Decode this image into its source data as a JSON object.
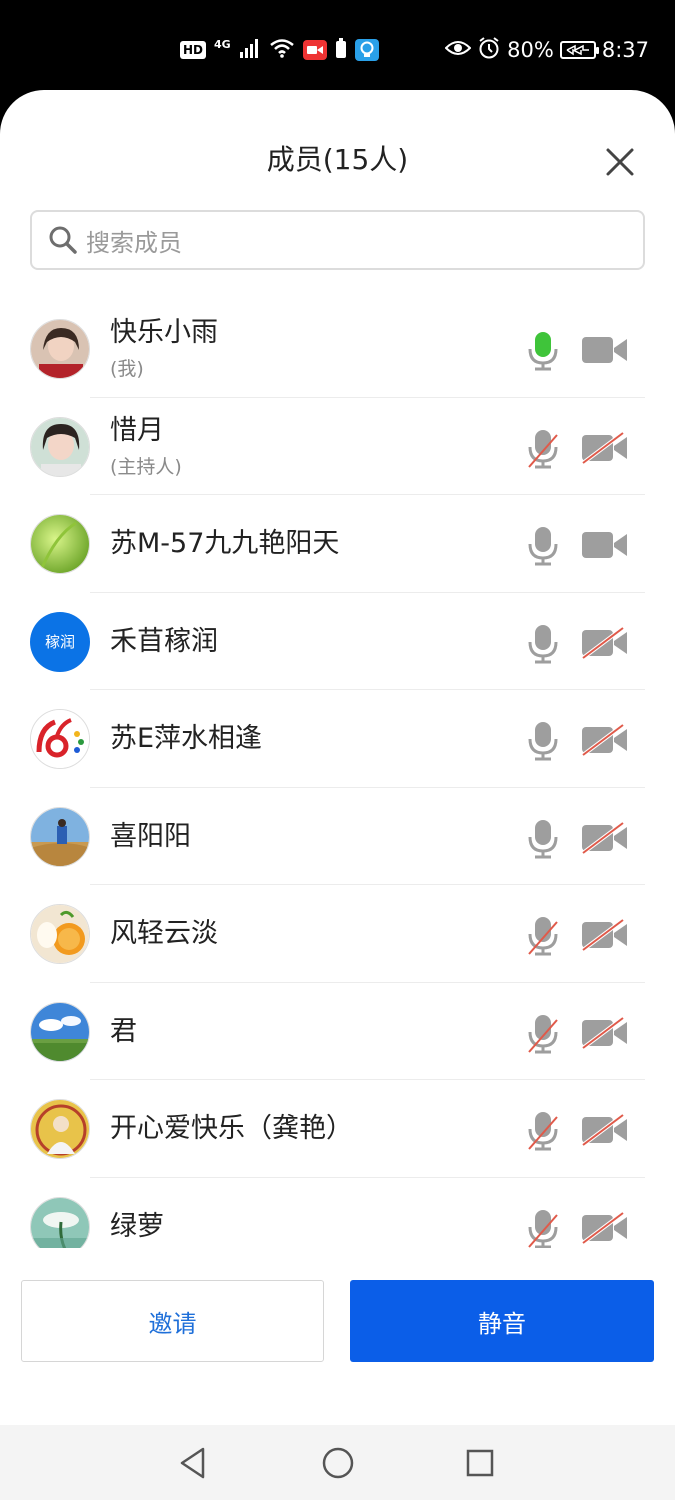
{
  "status_bar": {
    "hd": "HD",
    "network": "4G",
    "battery_percent": "80%",
    "time": "8:37",
    "icons": [
      "hd-badge",
      "signal-icon",
      "wifi-icon",
      "screen-record-icon",
      "battery-small-icon",
      "bulb-icon",
      "eye-icon",
      "alarm-icon",
      "battery-icon"
    ]
  },
  "header": {
    "title": "成员(15人)",
    "close_icon": "close-icon"
  },
  "search": {
    "placeholder": "搜索成员",
    "icon": "search-icon"
  },
  "members": [
    {
      "name": "快乐小雨",
      "role": "(我)",
      "avatar": "photo",
      "mic": "active",
      "camera": "on"
    },
    {
      "name": "惜月",
      "role": "(主持人)",
      "avatar": "photo",
      "mic": "muted",
      "camera": "off"
    },
    {
      "name": "苏M-57九九艳阳天",
      "role": "",
      "avatar": "photo",
      "mic": "on",
      "camera": "on"
    },
    {
      "name": "禾苜稼润",
      "role": "",
      "avatar": "text",
      "avatar_text": "稼润",
      "mic": "on",
      "camera": "off"
    },
    {
      "name": "苏E萍水相逢",
      "role": "",
      "avatar": "logo",
      "mic": "on",
      "camera": "off"
    },
    {
      "name": "喜阳阳",
      "role": "",
      "avatar": "photo",
      "mic": "on",
      "camera": "off"
    },
    {
      "name": "风轻云淡",
      "role": "",
      "avatar": "photo",
      "mic": "muted",
      "camera": "off"
    },
    {
      "name": "君",
      "role": "",
      "avatar": "photo",
      "mic": "muted",
      "camera": "off"
    },
    {
      "name": "开心爱快乐（龚艳）",
      "role": "",
      "avatar": "photo",
      "mic": "muted",
      "camera": "off"
    },
    {
      "name": "绿萝",
      "role": "",
      "avatar": "photo",
      "mic": "muted",
      "camera": "off"
    }
  ],
  "buttons": {
    "invite": "邀请",
    "mute": "静音"
  },
  "colors": {
    "primary": "#0b5ee8",
    "mic_active": "#3fc43a",
    "muted_slash": "#e05a4a",
    "icon_gray": "#9e9e9e"
  },
  "nav": {
    "icons": [
      "back-icon",
      "home-icon",
      "recents-icon"
    ]
  }
}
